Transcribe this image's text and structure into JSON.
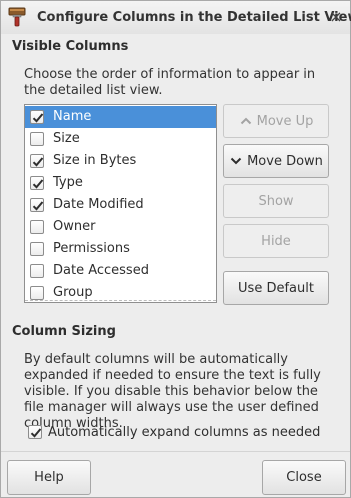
{
  "window": {
    "title": "Configure Columns in the Detailed List View",
    "close_glyph": "×"
  },
  "visible_columns": {
    "heading": "Visible Columns",
    "description": "Choose the order of information to appear in the detailed list view.",
    "items": [
      {
        "label": "Name",
        "checked": true,
        "selected": true
      },
      {
        "label": "Size",
        "checked": false,
        "selected": false
      },
      {
        "label": "Size in Bytes",
        "checked": true,
        "selected": false
      },
      {
        "label": "Type",
        "checked": true,
        "selected": false
      },
      {
        "label": "Date Modified",
        "checked": true,
        "selected": false
      },
      {
        "label": "Owner",
        "checked": false,
        "selected": false
      },
      {
        "label": "Permissions",
        "checked": false,
        "selected": false
      },
      {
        "label": "Date Accessed",
        "checked": false,
        "selected": false
      },
      {
        "label": "Group",
        "checked": false,
        "selected": false
      }
    ],
    "buttons": {
      "move_up": "Move Up",
      "move_down": "Move Down",
      "show": "Show",
      "hide": "Hide",
      "use_default": "Use Default"
    }
  },
  "column_sizing": {
    "heading": "Column Sizing",
    "description": "By default columns will be automatically expanded if needed to ensure the text is fully visible. If you disable this behavior below the file manager will always use the user defined column widths.",
    "auto_expand_label": "Automatically expand columns as needed",
    "auto_expand_checked": true
  },
  "footer": {
    "help": "Help",
    "close": "Close"
  },
  "colors": {
    "selection": "#4a90d9",
    "window_bg": "#ededed"
  }
}
